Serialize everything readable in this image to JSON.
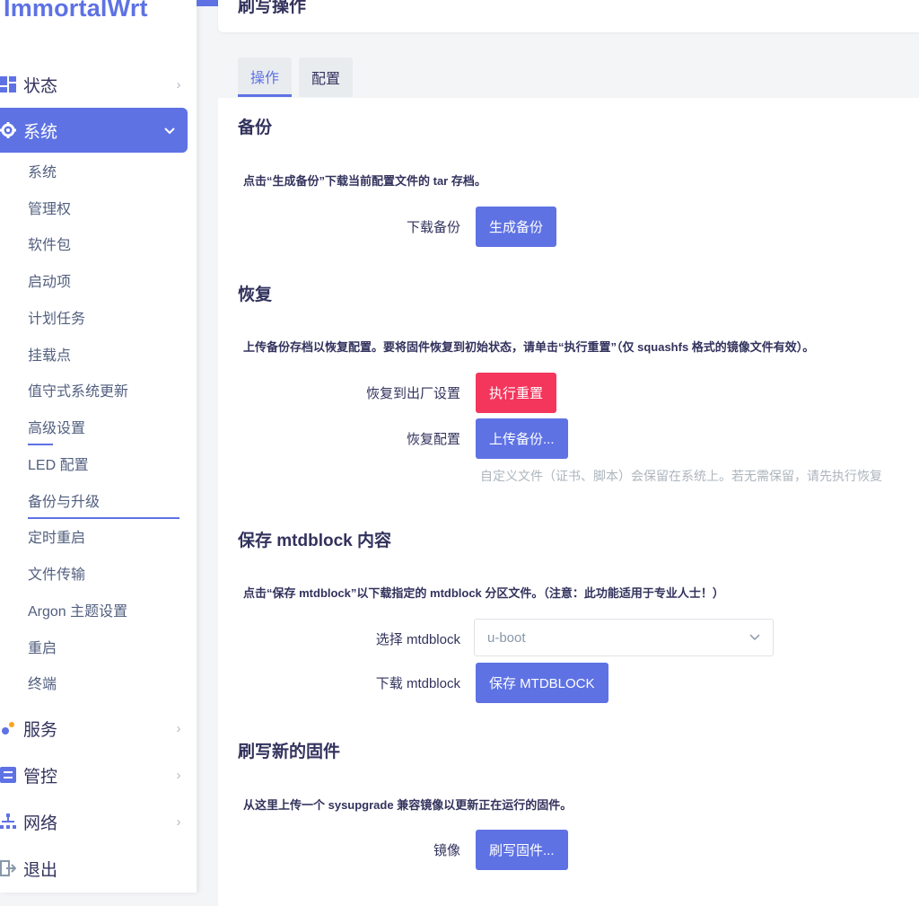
{
  "app": {
    "logo": "ImmortalWrt"
  },
  "header": {
    "title": "刷写操作"
  },
  "sidebar": {
    "top_items": [
      {
        "label": "状态",
        "icon": "dashboard-icon"
      },
      {
        "label": "系统",
        "icon": "gear-icon"
      },
      {
        "label": "服务",
        "icon": "services-icon"
      },
      {
        "label": "管控",
        "icon": "sliders-icon"
      },
      {
        "label": "网络",
        "icon": "network-icon"
      },
      {
        "label": "退出",
        "icon": "logout-icon"
      }
    ],
    "sub_items": [
      "系统",
      "管理权",
      "软件包",
      "启动项",
      "计划任务",
      "挂载点",
      "值守式系统更新",
      "高级设置",
      "LED 配置",
      "备份与升级",
      "定时重启",
      "文件传输",
      "Argon 主题设置",
      "重启",
      "终端"
    ]
  },
  "tabs": [
    {
      "label": "操作",
      "active": true
    },
    {
      "label": "配置",
      "active": false
    }
  ],
  "backup": {
    "title": "备份",
    "description": "点击“生成备份”下载当前配置文件的 tar 存档。",
    "download_label": "下载备份",
    "generate_button": "生成备份"
  },
  "restore": {
    "title": "恢复",
    "description": "上传备份存档以恢复配置。要将固件恢复到初始状态，请单击“执行重置”（仅 squashfs 格式的镜像文件有效）。",
    "factory_label": "恢复到出厂设置",
    "reset_button": "执行重置",
    "restore_label": "恢复配置",
    "upload_button": "上传备份...",
    "hint": "自定义文件（证书、脚本）会保留在系统上。若无需保留，请先执行恢复"
  },
  "mtdblock": {
    "title": "保存 mtdblock 内容",
    "description": "点击“保存 mtdblock”以下载指定的 mtdblock 分区文件。（注意：此功能适用于专业人士！）",
    "select_label": "选择 mtdblock",
    "selected": "u-boot",
    "download_label": "下载 mtdblock",
    "save_button": "保存 MTDBLOCK"
  },
  "flash": {
    "title": "刷写新的固件",
    "description": "从这里上传一个 sysupgrade 兼容镜像以更新正在运行的固件。",
    "image_label": "镜像",
    "flash_button": "刷写固件..."
  },
  "colors": {
    "accent": "#5e72e4",
    "danger": "#f5365c"
  }
}
